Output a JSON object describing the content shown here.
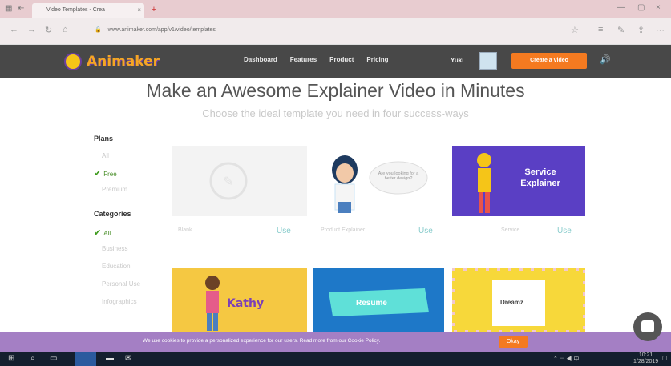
{
  "browser": {
    "tab_title": "Video Templates - Crea",
    "tab_close": "×",
    "new_tab": "+",
    "min": "—",
    "max": "▢",
    "close": "×",
    "back": "←",
    "forward": "→",
    "refresh": "↻",
    "home": "⌂",
    "url": "www.animaker.com/app/v1/video/templates",
    "lock": "🔒"
  },
  "site": {
    "logo_text": "Animaker",
    "nav": [
      "Dashboard",
      "Features",
      "Product",
      "Pricing"
    ],
    "user_name": "Yuki",
    "cta_label": "Create a video",
    "speaker_icon": "🔊"
  },
  "hero": {
    "title": "Make an Awesome Explainer Video in Minutes",
    "subtitle": "Choose the ideal template you need in four success-ways"
  },
  "sidebar": {
    "plans_heading": "Plans",
    "plans": [
      {
        "label": "All",
        "selected": false
      },
      {
        "label": "Free",
        "selected": true
      },
      {
        "label": "Premium",
        "selected": false
      }
    ],
    "categories_heading": "Categories",
    "categories": [
      {
        "label": "All",
        "selected": true
      },
      {
        "label": "Business",
        "selected": false
      },
      {
        "label": "Education",
        "selected": false
      },
      {
        "label": "Personal Use",
        "selected": false
      },
      {
        "label": "Infographics",
        "selected": false
      }
    ]
  },
  "cards_row1": [
    {
      "footer": "Blank",
      "use": "Use"
    },
    {
      "footer": "Product Explainer",
      "use": "Use",
      "bubble": "Are you looking for a better design?"
    },
    {
      "footer": "Service",
      "use": "Use",
      "title": "Service Explainer"
    }
  ],
  "cards_row2": [
    {
      "title": "Kathy"
    },
    {
      "title": "Resume"
    },
    {
      "title": "Dreamz"
    }
  ],
  "cookie": {
    "text": "We use cookies to provide a personalized experience for our users. Read more from our Cookie Policy.",
    "ok": "Okay"
  },
  "taskbar": {
    "time": "10:21",
    "date": "1/28/2019"
  }
}
